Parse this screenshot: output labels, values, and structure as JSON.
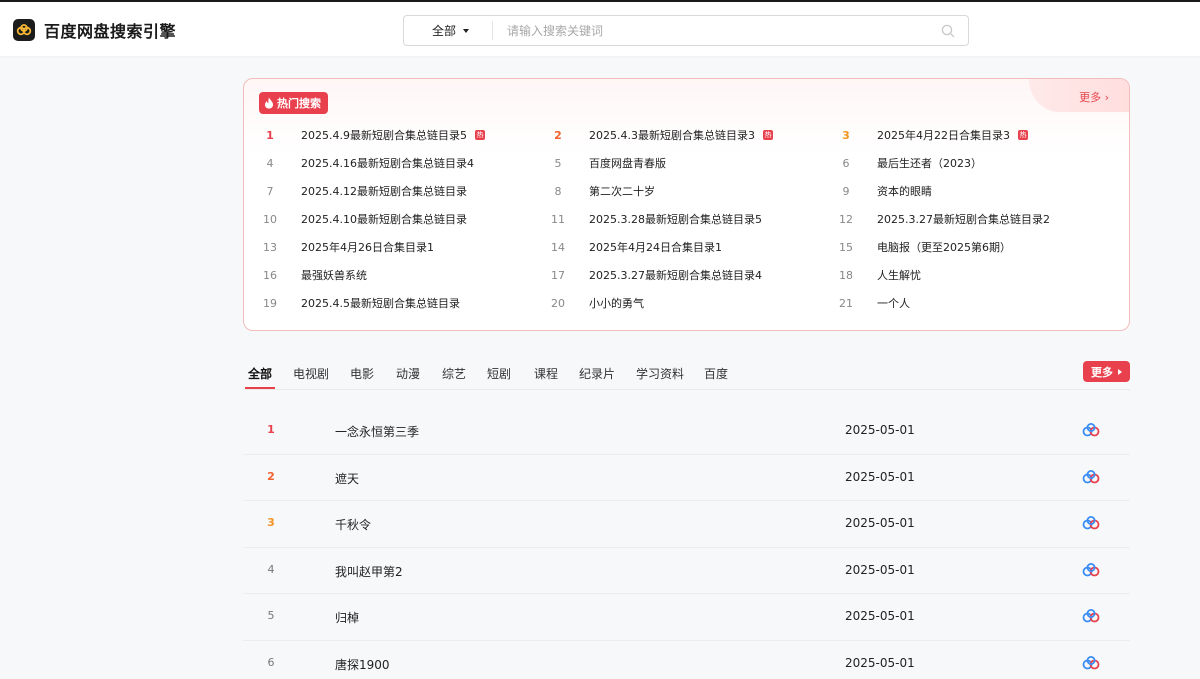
{
  "header": {
    "logo_text": "百度网盘搜索引擎",
    "search_scope": "全部",
    "search_placeholder": "请输入搜索关键词"
  },
  "hot": {
    "badge": "热门搜索",
    "more": "更多 ›",
    "tag_text": "热",
    "items": [
      {
        "rank": "1",
        "title": "2025.4.9最新短剧合集总链目录5",
        "hot": true
      },
      {
        "rank": "2",
        "title": "2025.4.3最新短剧合集总链目录3",
        "hot": true
      },
      {
        "rank": "3",
        "title": "2025年4月22日合集目录3",
        "hot": true
      },
      {
        "rank": "4",
        "title": "2025.4.16最新短剧合集总链目录4",
        "hot": false
      },
      {
        "rank": "5",
        "title": "百度网盘青春版",
        "hot": false
      },
      {
        "rank": "6",
        "title": "最后生还者（2023）",
        "hot": false
      },
      {
        "rank": "7",
        "title": "2025.4.12最新短剧合集总链目录",
        "hot": false
      },
      {
        "rank": "8",
        "title": "第二次二十岁",
        "hot": false
      },
      {
        "rank": "9",
        "title": "资本的眼睛",
        "hot": false
      },
      {
        "rank": "10",
        "title": "2025.4.10最新短剧合集总链目录",
        "hot": false
      },
      {
        "rank": "11",
        "title": "2025.3.28最新短剧合集总链目录5",
        "hot": false
      },
      {
        "rank": "12",
        "title": "2025.3.27最新短剧合集总链目录2",
        "hot": false
      },
      {
        "rank": "13",
        "title": "2025年4月26日合集目录1",
        "hot": false
      },
      {
        "rank": "14",
        "title": "2025年4月24日合集目录1",
        "hot": false
      },
      {
        "rank": "15",
        "title": "电脑报（更至2025第6期）",
        "hot": false
      },
      {
        "rank": "16",
        "title": "最强妖兽系统",
        "hot": false
      },
      {
        "rank": "17",
        "title": "2025.3.27最新短剧合集总链目录4",
        "hot": false
      },
      {
        "rank": "18",
        "title": "人生解忧",
        "hot": false
      },
      {
        "rank": "19",
        "title": "2025.4.5最新短剧合集总链目录",
        "hot": false
      },
      {
        "rank": "20",
        "title": "小小的勇气",
        "hot": false
      },
      {
        "rank": "21",
        "title": "一个人",
        "hot": false
      }
    ]
  },
  "tabs": {
    "items": [
      "全部",
      "电视剧",
      "电影",
      "动漫",
      "综艺",
      "短剧",
      "课程",
      "纪录片",
      "学习资料",
      "百度"
    ],
    "active": 0,
    "more": "更多"
  },
  "results": [
    {
      "rank": "1",
      "title": "一念永恒第三季",
      "date": "2025-05-01"
    },
    {
      "rank": "2",
      "title": "遮天",
      "date": "2025-05-01"
    },
    {
      "rank": "3",
      "title": "千秋令",
      "date": "2025-05-01"
    },
    {
      "rank": "4",
      "title": "我叫赵甲第2",
      "date": "2025-05-01"
    },
    {
      "rank": "5",
      "title": "归棹",
      "date": "2025-05-01"
    },
    {
      "rank": "6",
      "title": "唐探1900",
      "date": "2025-05-01"
    }
  ],
  "colors": {
    "accent": "#e8414d",
    "rank2": "#f2622e",
    "rank3": "#f29422",
    "cloud_blue": "#3a8df5",
    "cloud_pink": "#e8414d"
  },
  "icons": {
    "logo": "cloud-logo-icon",
    "search": "search-icon",
    "hot": "flame-icon",
    "result": "baidu-pan-icon"
  }
}
